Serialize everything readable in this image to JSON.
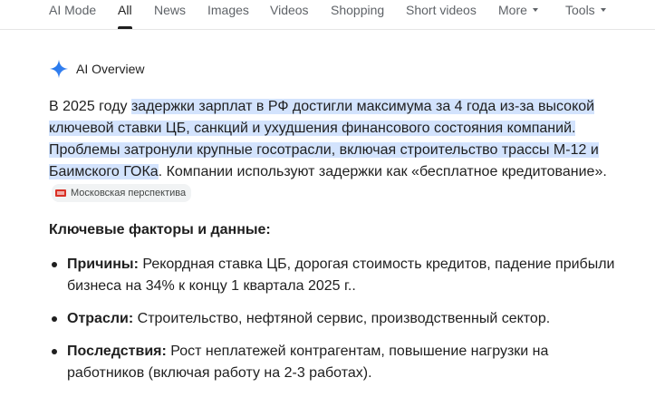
{
  "tabs": [
    {
      "label": "AI Mode",
      "active": false
    },
    {
      "label": "All",
      "active": true
    },
    {
      "label": "News",
      "active": false
    },
    {
      "label": "Images",
      "active": false
    },
    {
      "label": "Videos",
      "active": false
    },
    {
      "label": "Shopping",
      "active": false
    },
    {
      "label": "Short videos",
      "active": false
    },
    {
      "label": "More",
      "active": false
    },
    {
      "label": "Tools",
      "active": false
    }
  ],
  "overview": {
    "title": "AI Overview",
    "icon": "gemini-sparkle-icon",
    "accent_color": "#4285f4",
    "highlight_color": "#d3e3fd",
    "summary": {
      "lead": "В 2025 году ",
      "highlighted": "задержки зарплат в РФ достигли максимума за 4 года из-за высокой ключевой ставки ЦБ, санкций и ухудшения финансового состояния компаний. Проблемы затронули крупные госотрасли, включая строительство трассы М-12 и Баимского ГОКа",
      "tail": ". Компании используют задержки как «бесплатное кредитование».",
      "source": "Московская перспектива"
    },
    "section_title": "Ключевые факторы и данные:",
    "factors": [
      {
        "term": "Причины:",
        "text": "Рекордная ставка ЦБ, дорогая стоимость кредитов, падение прибыли бизнеса на 34% к концу 1 квартала 2025 г.."
      },
      {
        "term": "Отрасли:",
        "text": "Строительство, нефтяной сервис, производственный сектор."
      },
      {
        "term": "Последствия:",
        "text": "Рост неплатежей контрагентам, повышение нагрузки на работников (включая работу на 2-3 работах)."
      }
    ]
  }
}
